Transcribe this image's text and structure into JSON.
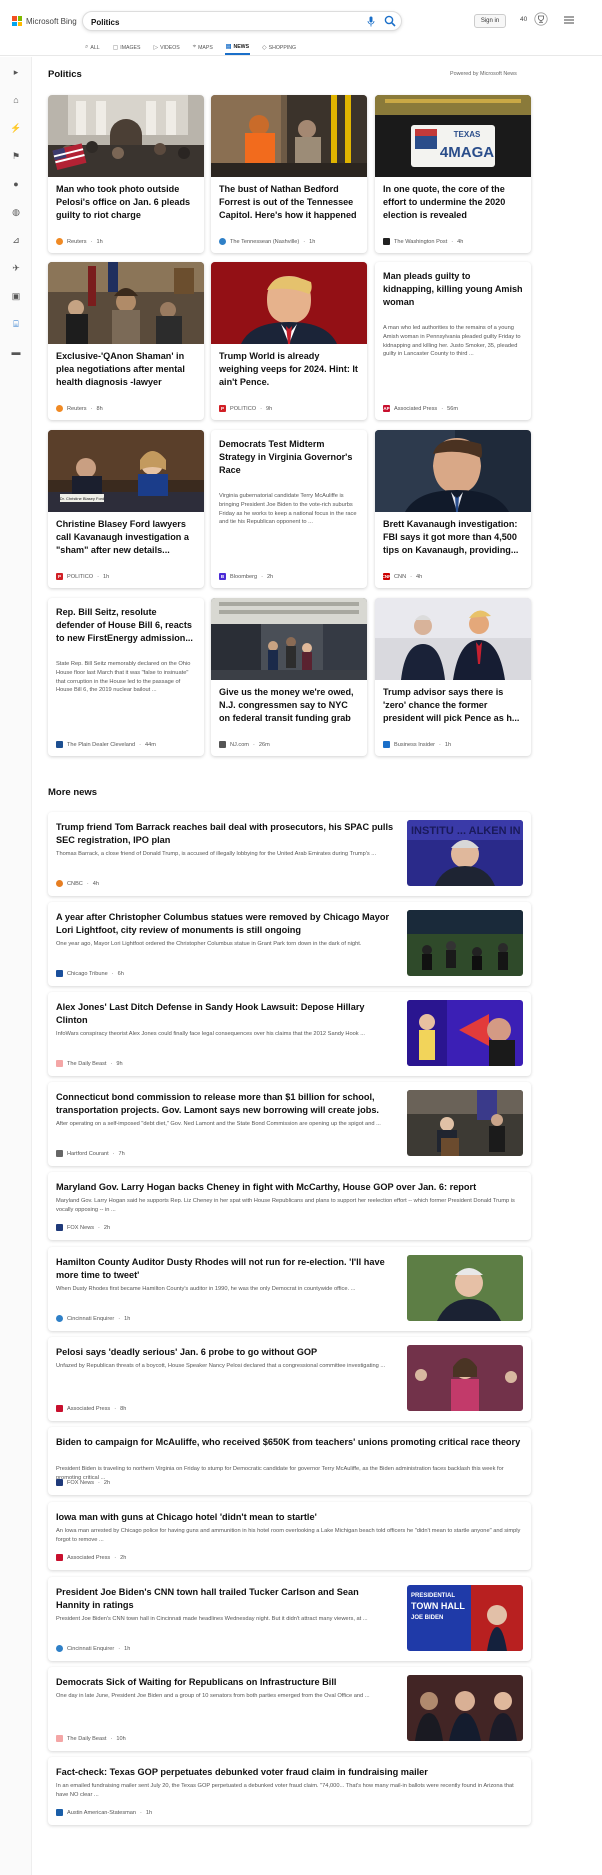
{
  "header": {
    "logo_text": "Microsoft Bing",
    "search_value": "Politics",
    "signin_label": "Sign in",
    "points": "40"
  },
  "tabs": [
    {
      "label": "ALL",
      "icon": "search-icon"
    },
    {
      "label": "IMAGES",
      "icon": "image-icon"
    },
    {
      "label": "VIDEOS",
      "icon": "video-icon"
    },
    {
      "label": "MAPS",
      "icon": "map-pin-icon"
    },
    {
      "label": "NEWS",
      "icon": "news-icon",
      "active": true
    },
    {
      "label": "SHOPPING",
      "icon": "shopping-tag-icon"
    }
  ],
  "page": {
    "title": "Politics",
    "powered_by": "Powered by Microsoft News",
    "more_news_title": "More news"
  },
  "cards": [
    {
      "title": "Man who took photo outside Pelosi's office on Jan. 6 pleads guilty to riot charge",
      "source": "Reuters",
      "time": "1h",
      "logo_color": "#f08a24"
    },
    {
      "title": "The bust of Nathan Bedford Forrest is out of the Tennessee Capitol. Here's how it happened",
      "source": "The Tennessean (Nashville)",
      "time": "1h",
      "logo_color": "#2f80c7"
    },
    {
      "title": "In one quote, the core of the effort to undermine the 2020 election is revealed",
      "source": "The Washington Post",
      "time": "4h",
      "logo_color": "#222222"
    },
    {
      "title": "Exclusive-'QAnon Shaman' in plea negotiations after mental health diagnosis -lawyer",
      "source": "Reuters",
      "time": "8h",
      "logo_color": "#f08a24"
    },
    {
      "title": "Trump World is already weighing veeps for 2024. Hint: It ain't Pence.",
      "source": "POLITICO",
      "time": "9h",
      "logo_color": "#d11f25"
    },
    {
      "title": "Man pleads guilty to kidnapping, killing young Amish woman",
      "desc": "A man who led authorities to the remains of a young Amish woman in Pennsylvania pleaded guilty Friday to kidnapping and killing her. Justo Smoker, 35, pleaded guilty in Lancaster County to third ...",
      "source": "Associated Press",
      "time": "56m",
      "logo_color": "#c8102e"
    },
    {
      "title": "Christine Blasey Ford lawyers call Kavanaugh investigation a \"sham\" after new details...",
      "source": "POLITICO",
      "time": "1h",
      "logo_color": "#d11f25"
    },
    {
      "title": "Democrats Test Midterm Strategy in Virginia Governor's Race",
      "desc": "Virginia gubernatorial candidate Terry McAuliffe is bringing President Joe Biden to the vote-rich suburbs Friday as he works to keep a national focus in the race and tie his Republican opponent to ...",
      "source": "Bloomberg",
      "time": "2h",
      "logo_color": "#4b2bd6"
    },
    {
      "title": "Brett Kavanaugh investigation: FBI says it got more than 4,500 tips on Kavanaugh, providing...",
      "source": "CNN",
      "time": "4h",
      "logo_color": "#cc0000"
    },
    {
      "title": "Rep. Bill Seitz, resolute defender of House Bill 6, reacts to new FirstEnergy admission...",
      "desc": "State Rep. Bill Seitz memorably declared on the Ohio House floor last March that it was \"false to insinuate\" that corruption in the House led to the passage of House Bill 6, the 2019 nuclear bailout ...",
      "source": "The Plain Dealer Cleveland",
      "time": "44m",
      "logo_color": "#1d4f91"
    },
    {
      "title": "Give us the money we're owed, N.J. congressmen say to NYC on federal transit funding grab",
      "source": "NJ.com",
      "time": "26m",
      "logo_color": "#555555"
    },
    {
      "title": "Trump advisor says there is 'zero' chance the former president will pick Pence as h...",
      "source": "Business Insider",
      "time": "1h",
      "logo_color": "#1a6fc9"
    }
  ],
  "more_news": [
    {
      "title": "Trump friend Tom Barrack reaches bail deal with prosecutors, his SPAC pulls SEC registration, IPO plan",
      "desc": "Thomas Barrack, a close friend of Donald Trump, is accused of illegally lobbying for the United Arab Emirates during Trump's ...",
      "source": "CNBC",
      "time": "4h",
      "logo_color": "#e67e22"
    },
    {
      "title": "A year after Christopher Columbus statues were removed by Chicago Mayor Lori Lightfoot, city review of monuments is still ongoing",
      "desc": "One year ago, Mayor Lori Lightfoot ordered the Christopher Columbus statue in Grant Park torn down in the dark of night.",
      "source": "Chicago Tribune",
      "time": "6h",
      "logo_color": "#1a4f9c"
    },
    {
      "title": "Alex Jones' Last Ditch Defense in Sandy Hook Lawsuit: Depose Hillary Clinton",
      "desc": "InfoWars conspiracy theorist Alex Jones could finally face legal consequences over his claims that the 2012 Sandy Hook ...",
      "source": "The Daily Beast",
      "time": "9h",
      "logo_color": "#f4a6a6"
    },
    {
      "title": "Connecticut bond commission to release more than $1 billion for school, transportation projects. Gov. Lamont says new borrowing will create jobs.",
      "desc": "After operating on a self-imposed \"debt diet,\" Gov. Ned Lamont and the State Bond Commission are opening up the spigot and ...",
      "source": "Hartford Courant",
      "time": "7h",
      "logo_color": "#666666"
    },
    {
      "title": "Maryland Gov. Larry Hogan backs Cheney in fight with McCarthy, House GOP over Jan. 6: report",
      "desc": "Maryland Gov. Larry Hogan said he supports Rep. Liz Cheney in her spat with House Republicans and plans to support her reelection effort -- which former President Donald Trump is vocally opposing -- in ...",
      "source": "FOX News",
      "time": "2h",
      "logo_color": "#1f3a7a"
    },
    {
      "title": "Hamilton County Auditor Dusty Rhodes will not run for re-election. 'I'll have more time to tweet'",
      "desc": "When Dusty Rhodes first became Hamilton County's auditor in 1990, he was the only Democrat in countywide office. ...",
      "source": "Cincinnati Enquirer",
      "time": "1h",
      "logo_color": "#2f80c7"
    },
    {
      "title": "Pelosi says 'deadly serious' Jan. 6 probe to go without GOP",
      "desc": "Unfazed by Republican threats of a boycott, House Speaker Nancy Pelosi declared that a congressional committee investigating ...",
      "source": "Associated Press",
      "time": "8h",
      "logo_color": "#c8102e"
    },
    {
      "title": "Biden to campaign for McAuliffe, who received $650K from teachers' unions promoting critical race theory",
      "desc": "President Biden is traveling to northern Virginia on Friday to stump for Democratic candidate for governor Terry McAuliffe, as the Biden administration faces backlash this week for promoting critical ...",
      "source": "FOX News",
      "time": "2h",
      "logo_color": "#1f3a7a"
    },
    {
      "title": "Iowa man with guns at Chicago hotel 'didn't mean to startle'",
      "desc": "An Iowa man arrested by Chicago police for having guns and ammunition in his hotel room overlooking a Lake Michigan beach told officers he \"didn't mean to startle anyone\" and simply forgot to remove ...",
      "source": "Associated Press",
      "time": "2h",
      "logo_color": "#c8102e"
    },
    {
      "title": "President Joe Biden's CNN town hall trailed Tucker Carlson and Sean Hannity in ratings",
      "desc": "President Joe Biden's CNN town hall in Cincinnati made headlines Wednesday night. But it didn't attract many viewers, at ...",
      "source": "Cincinnati Enquirer",
      "time": "1h",
      "logo_color": "#2f80c7"
    },
    {
      "title": "Democrats Sick of Waiting for Republicans on Infrastructure Bill",
      "desc": "One day in late June, President Joe Biden and a group of 10 senators from both parties emerged from the Oval Office and ...",
      "source": "The Daily Beast",
      "time": "10h",
      "logo_color": "#f4a6a6"
    },
    {
      "title": "Fact-check: Texas GOP perpetuates debunked voter fraud claim in fundraising mailer",
      "desc": "In an emailed fundraising mailer sent July 20, the Texas GOP perpetuated a debunked voter fraud claim. \"74,000... That's how many mail-in ballots were recently found in Arizona that have NO clear ...",
      "source": "Austin American-Statesman",
      "time": "1h",
      "logo_color": "#1a5ea8"
    }
  ],
  "thumb_text": {
    "texas_plate_state": "TEXAS",
    "texas_plate_number": "4MAGA",
    "barrack_banner": "INSTITU ... ALKEN IN",
    "town_hall_banner_1": "PRESIDENTIAL",
    "town_hall_banner_2": "TOWN HALL",
    "town_hall_banner_3": "JOE BIDEN",
    "blasey_nameplate": "Dr. Christine Blasey Ford"
  }
}
